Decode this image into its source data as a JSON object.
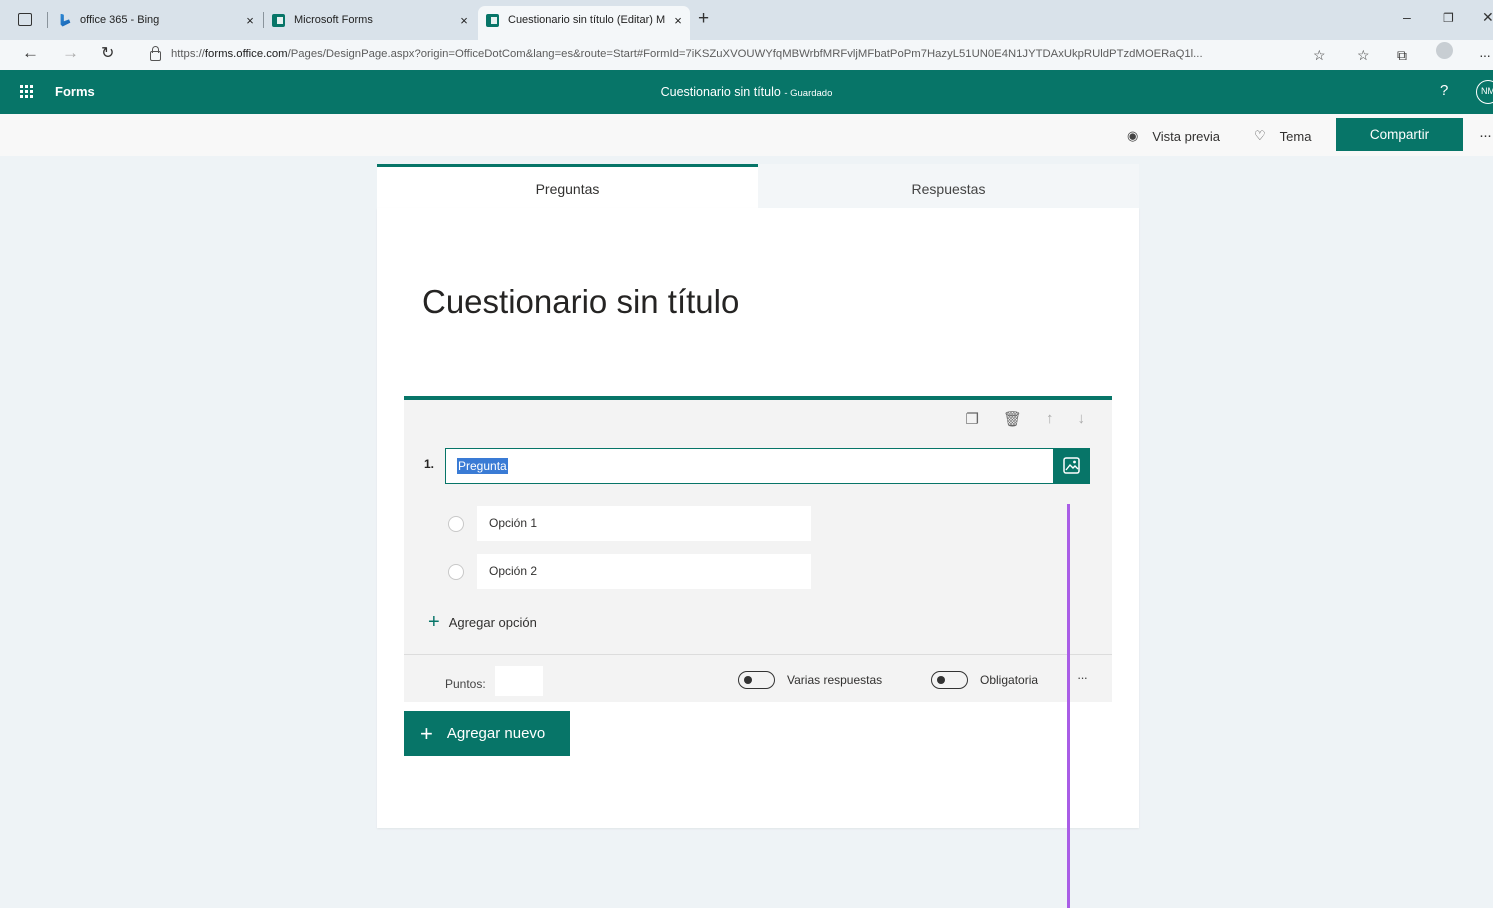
{
  "browser": {
    "tabs": [
      {
        "label": "office 365 - Bing",
        "close": "×",
        "icon": "bing-icon"
      },
      {
        "label": "Microsoft Forms",
        "close": "×",
        "icon": "forms-icon"
      },
      {
        "label": "Cuestionario sin título (Editar) M",
        "close": "×",
        "icon": "forms-icon",
        "active": true
      }
    ],
    "new_tab": "+",
    "window_controls": {
      "minimize": "–",
      "restore": "❐",
      "close": "✕"
    },
    "url_prefix": "https://",
    "url_host": "forms.office.com",
    "url_rest": "/Pages/DesignPage.aspx?origin=OfficeDotCom&lang=es&route=Start#FormId=7iKSZuXVOUWYfqMBWrbfMRFvljMFbatPoPm7HazyL51UN0E4N1JYTDAxUkpRUldPTzdMOERaQ1l..."
  },
  "app": {
    "name": "Forms",
    "doc_title": "Cuestionario sin título",
    "save_status": "- Guardado",
    "help": "?",
    "avatar_initials": "NM",
    "accent": "#077568"
  },
  "commands": {
    "preview": "Vista previa",
    "theme": "Tema",
    "share": "Compartir",
    "more": "···"
  },
  "form_tabs": {
    "questions": "Preguntas",
    "responses": "Respuestas"
  },
  "form": {
    "title": "Cuestionario sin título",
    "question": {
      "number": "1.",
      "text": "Pregunta",
      "options": [
        "Opción 1",
        "Opción 2"
      ],
      "add_option": "Agregar opción",
      "points_label": "Puntos:",
      "points_value": "",
      "multiple_answers": "Varias respuestas",
      "required": "Obligatoria",
      "more": "···"
    },
    "add_new": "Agregar nuevo"
  }
}
